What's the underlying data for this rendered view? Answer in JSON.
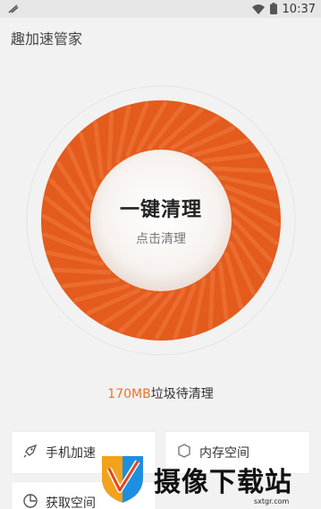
{
  "status_bar": {
    "time": "10:37"
  },
  "header": {
    "title": "趣加速管家"
  },
  "main": {
    "clean_button": {
      "title": "一键清理",
      "subtitle": "点击清理"
    },
    "junk": {
      "size": "170MB",
      "label": "垃圾待清理"
    }
  },
  "cards": [
    {
      "label": "手机加速",
      "icon": "rocket-icon"
    },
    {
      "label": "内存空间",
      "icon": "memory-icon"
    },
    {
      "label": "获取空间",
      "icon": "storage-icon"
    }
  ],
  "watermark": {
    "text": "摄像下载站",
    "url": "sxtgr.com"
  },
  "colors": {
    "accent": "#e8752f",
    "ring": "#e35b1d"
  }
}
